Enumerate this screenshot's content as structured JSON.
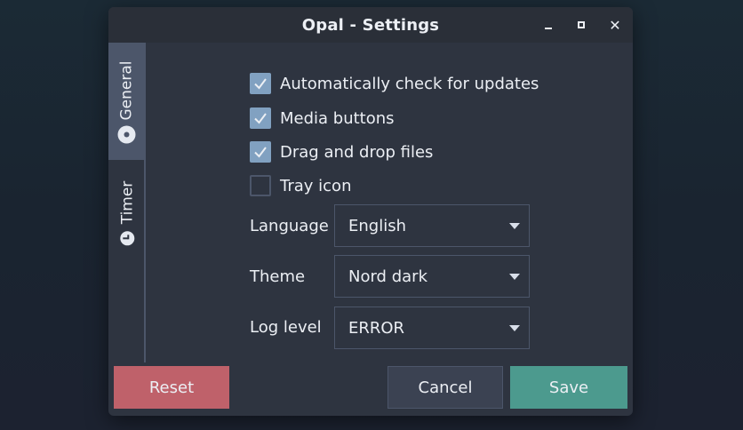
{
  "window": {
    "title": "Opal - Settings",
    "controls": [
      "minimize-icon",
      "maximize-icon",
      "close-icon"
    ]
  },
  "tabs": [
    {
      "label": "General",
      "icon": "gear-icon",
      "active": true
    },
    {
      "label": "Timer",
      "icon": "clock-icon",
      "active": false
    }
  ],
  "settings": {
    "checkboxes": [
      {
        "label": "Automatically check for updates",
        "checked": true
      },
      {
        "label": "Media buttons",
        "checked": true
      },
      {
        "label": "Drag and drop files",
        "checked": true
      },
      {
        "label": "Tray icon",
        "checked": false
      }
    ],
    "language": {
      "label": "Language",
      "value": "English"
    },
    "theme": {
      "label": "Theme",
      "value": "Nord dark"
    },
    "log_level": {
      "label": "Log level",
      "value": "ERROR"
    }
  },
  "buttons": {
    "reset": "Reset",
    "cancel": "Cancel",
    "save": "Save"
  },
  "colors": {
    "window_bg": "#2e3440",
    "accent_checkbox": "#81a1c1",
    "reset": "#bf616a",
    "save": "#4c9a8e"
  }
}
